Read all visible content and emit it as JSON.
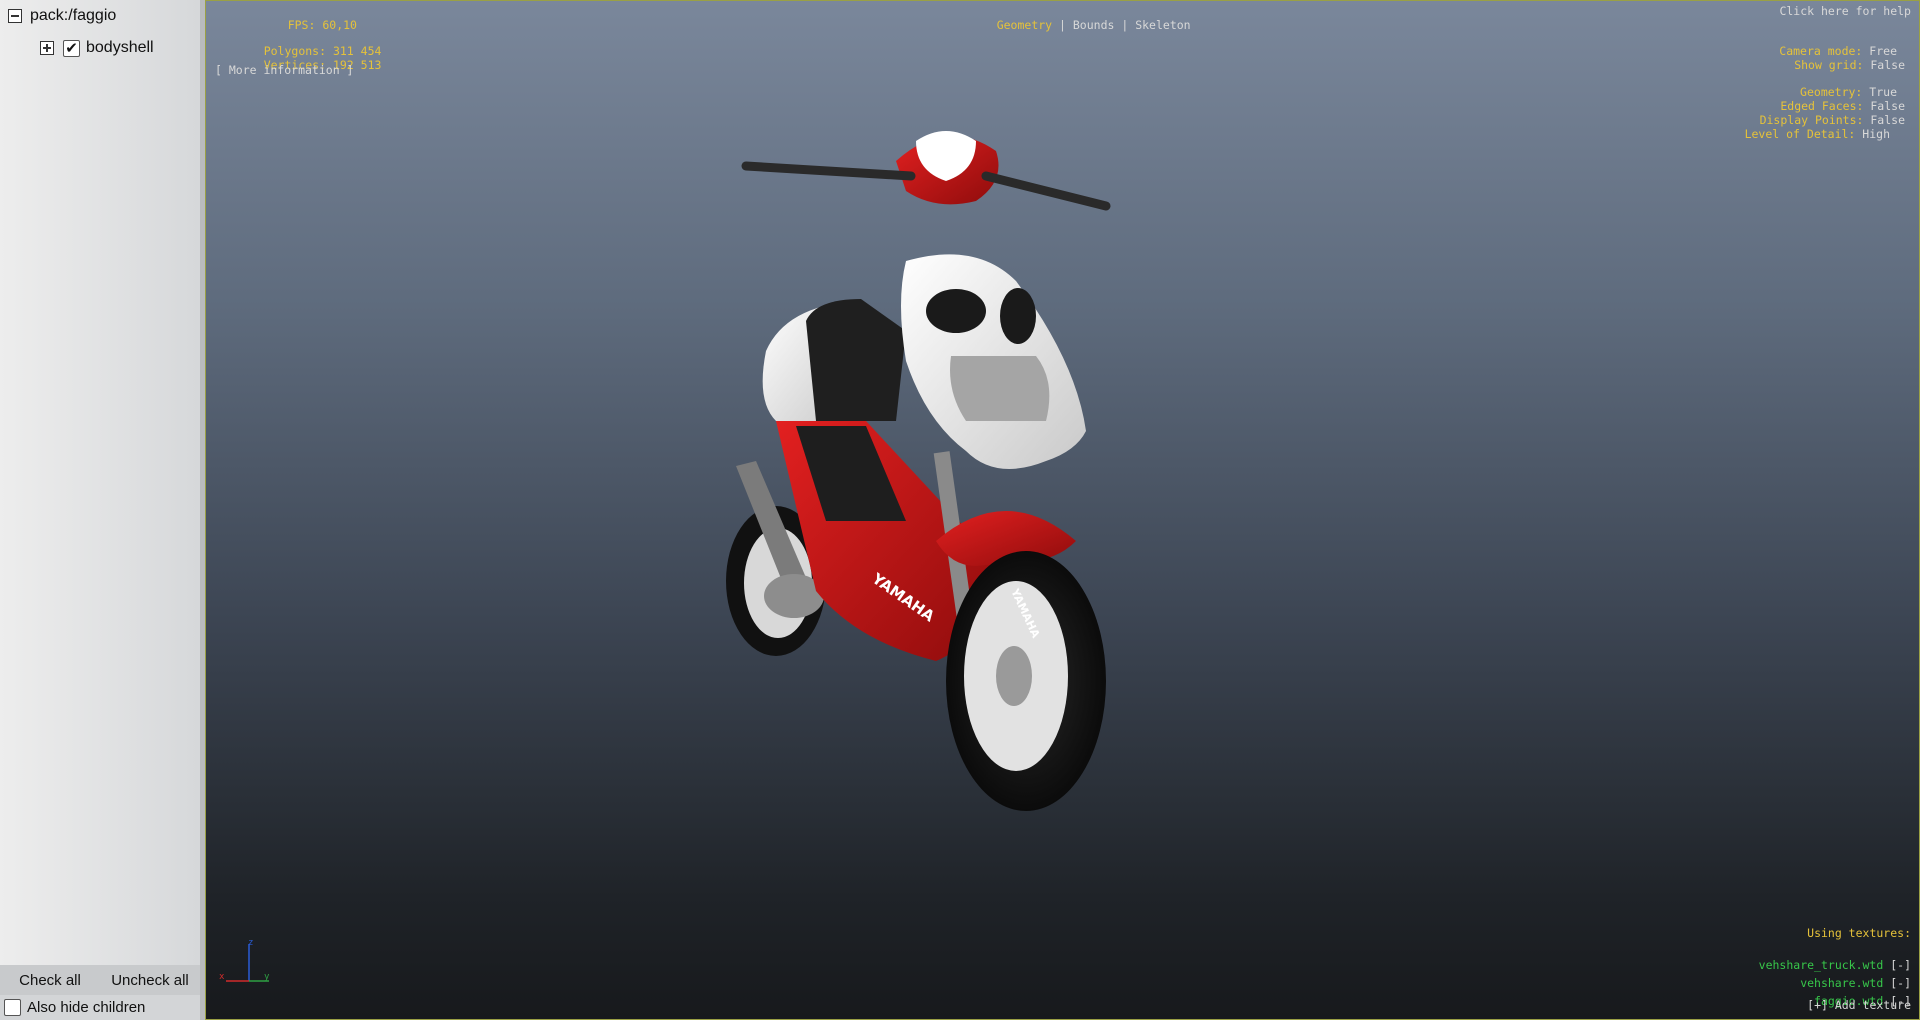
{
  "tree": {
    "root_label": "pack:/faggio",
    "child_label": "bodyshell",
    "child_checked": "✔"
  },
  "buttons": {
    "check_all": "Check all",
    "uncheck_all": "Uncheck all"
  },
  "options": {
    "also_hide_children": "Also hide children"
  },
  "hud": {
    "fps_label": "FPS:",
    "fps_value": "60,10",
    "polygons_label": "Polygons:",
    "polygons_value": "311 454",
    "vertices_label": "Vertices:",
    "vertices_value": "192 513",
    "more_info": "[ More information ]",
    "modes": [
      "Geometry",
      "Bounds",
      "Skeleton"
    ],
    "help": "Click here for help",
    "camera_mode_label": "Camera mode:",
    "camera_mode_value": "Free",
    "show_grid_label": "Show grid:",
    "show_grid_value": "False",
    "geometry_label": "Geometry:",
    "geometry_value": "True",
    "edged_faces_label": "Edged Faces:",
    "edged_faces_value": "False",
    "display_points_label": "Display Points:",
    "display_points_value": "False",
    "lod_label": "Level of Detail:",
    "lod_value": "High",
    "using_textures": "Using textures:",
    "textures": [
      "vehshare_truck.wtd",
      "vehshare.wtd",
      "faggio.wtd"
    ],
    "remove_label": "[-]",
    "add_texture": "[+] Add texture"
  },
  "axes": {
    "x": "x",
    "y": "y",
    "z": "z"
  },
  "colors": {
    "hud_yellow": "#e5c23a",
    "texture_green": "#37c64a",
    "scooter_red": "#d31616"
  }
}
